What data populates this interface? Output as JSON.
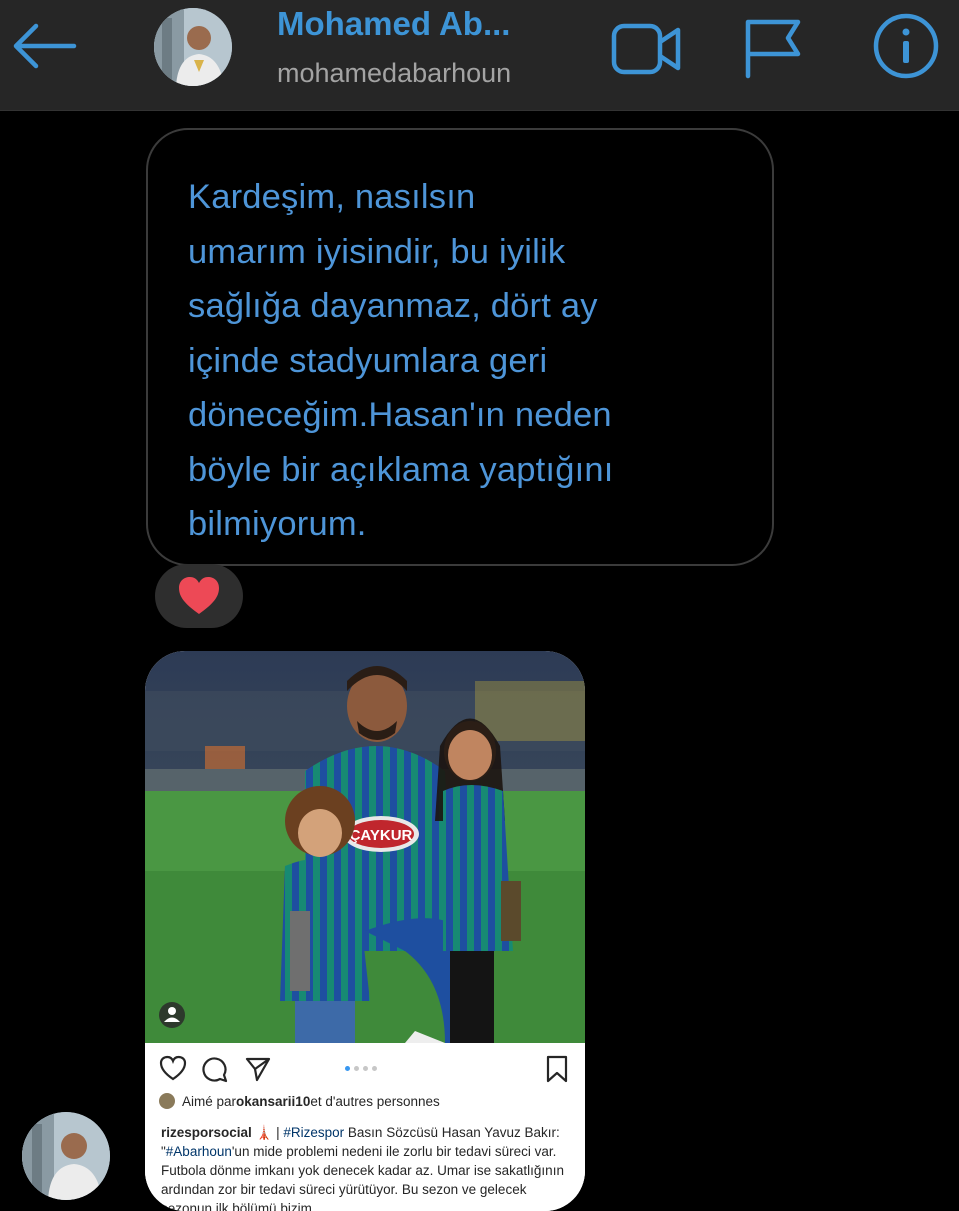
{
  "header": {
    "name": "Mohamed Ab...",
    "username": "mohamedabarhoun",
    "icons": [
      "back-arrow-icon",
      "video-camera-icon",
      "flag-icon",
      "info-icon"
    ],
    "accent_color": "#3d94d6"
  },
  "message": {
    "lines": [
      "Kardeşim, nasılsın",
      "umarım iyisindir, bu iyilik",
      "sağlığa dayanmaz, dört ay",
      "içinde stadyumlara geri",
      "döneceğim.Hasan'ın neden",
      "böyle bir açıklama yaptığını",
      "bilmiyorum."
    ],
    "reaction": "heart-icon",
    "text_color": "#4e95d8"
  },
  "shared_post": {
    "photo_text": "ÇAYKUR",
    "liked_by_prefix": "Aimé par ",
    "liked_by_user": "okansarii10",
    "liked_by_suffix": " et d'autres personnes",
    "caption_user": "rizesporsocial",
    "caption_rest_1": " | ",
    "caption_hashtag_1": "#Rizespor",
    "caption_rest_2": " Basın Sözcüsü Hasan Yavuz Bakır: \"",
    "caption_hashtag_2": "#Abarhoun",
    "caption_rest_3": "'un mide problemi nedeni ile zorlu bir tedavi süreci var. Futbola dönme imkanı yok denecek kadar az. Umar ise sakatlığının ardından zor bir tedavi süreci yürütüyor. Bu sezon ve gelecek sezonun ilk bölümü bizim",
    "carousel_dots": 4,
    "carousel_active": 1
  }
}
